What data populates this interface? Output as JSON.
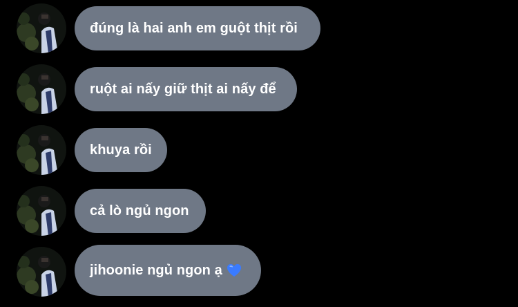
{
  "conversation": {
    "messages": [
      {
        "text": "đúng là hai anh em guột thịt rồi"
      },
      {
        "text": "ruột ai nấy giữ thịt ai nấy để"
      },
      {
        "text": "khuya rồi"
      },
      {
        "text": "cả lò ngủ ngon"
      },
      {
        "text": "jihoonie ngủ ngon ạ",
        "emoji": "blue-heart-icon"
      }
    ]
  },
  "colors": {
    "background": "#000000",
    "bubble": "#6f7886",
    "text": "#ffffff",
    "heart": "#3a7bff"
  }
}
